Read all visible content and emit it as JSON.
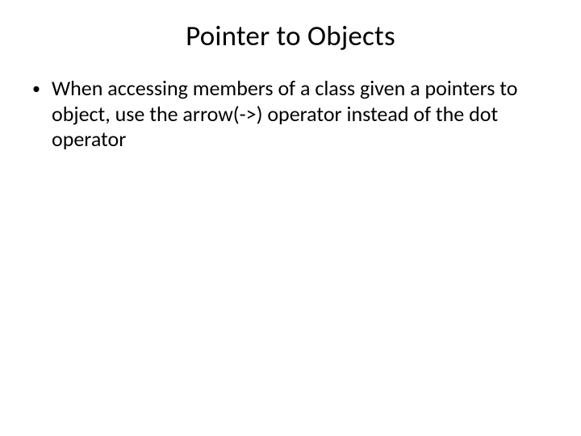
{
  "slide": {
    "title": "Pointer to Objects",
    "bullets": [
      {
        "marker": "•",
        "text": "When accessing members of a class given a pointers to object, use the arrow(->) operator instead of the dot operator"
      }
    ]
  }
}
